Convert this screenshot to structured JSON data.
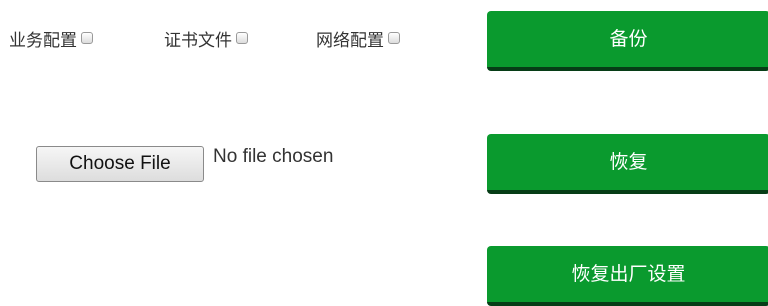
{
  "backup": {
    "options": [
      {
        "label": "业务配置",
        "checked": false
      },
      {
        "label": "证书文件",
        "checked": false
      },
      {
        "label": "网络配置",
        "checked": false
      }
    ],
    "backup_button": "备份"
  },
  "restore": {
    "choose_file_button": "Choose File",
    "file_status": "No file chosen",
    "restore_button": "恢复"
  },
  "factory_reset": {
    "button": "恢复出厂设置"
  },
  "colors": {
    "button_bg": "#0a9a2e",
    "button_shadow": "#063d16",
    "button_text": "#ffffff"
  }
}
